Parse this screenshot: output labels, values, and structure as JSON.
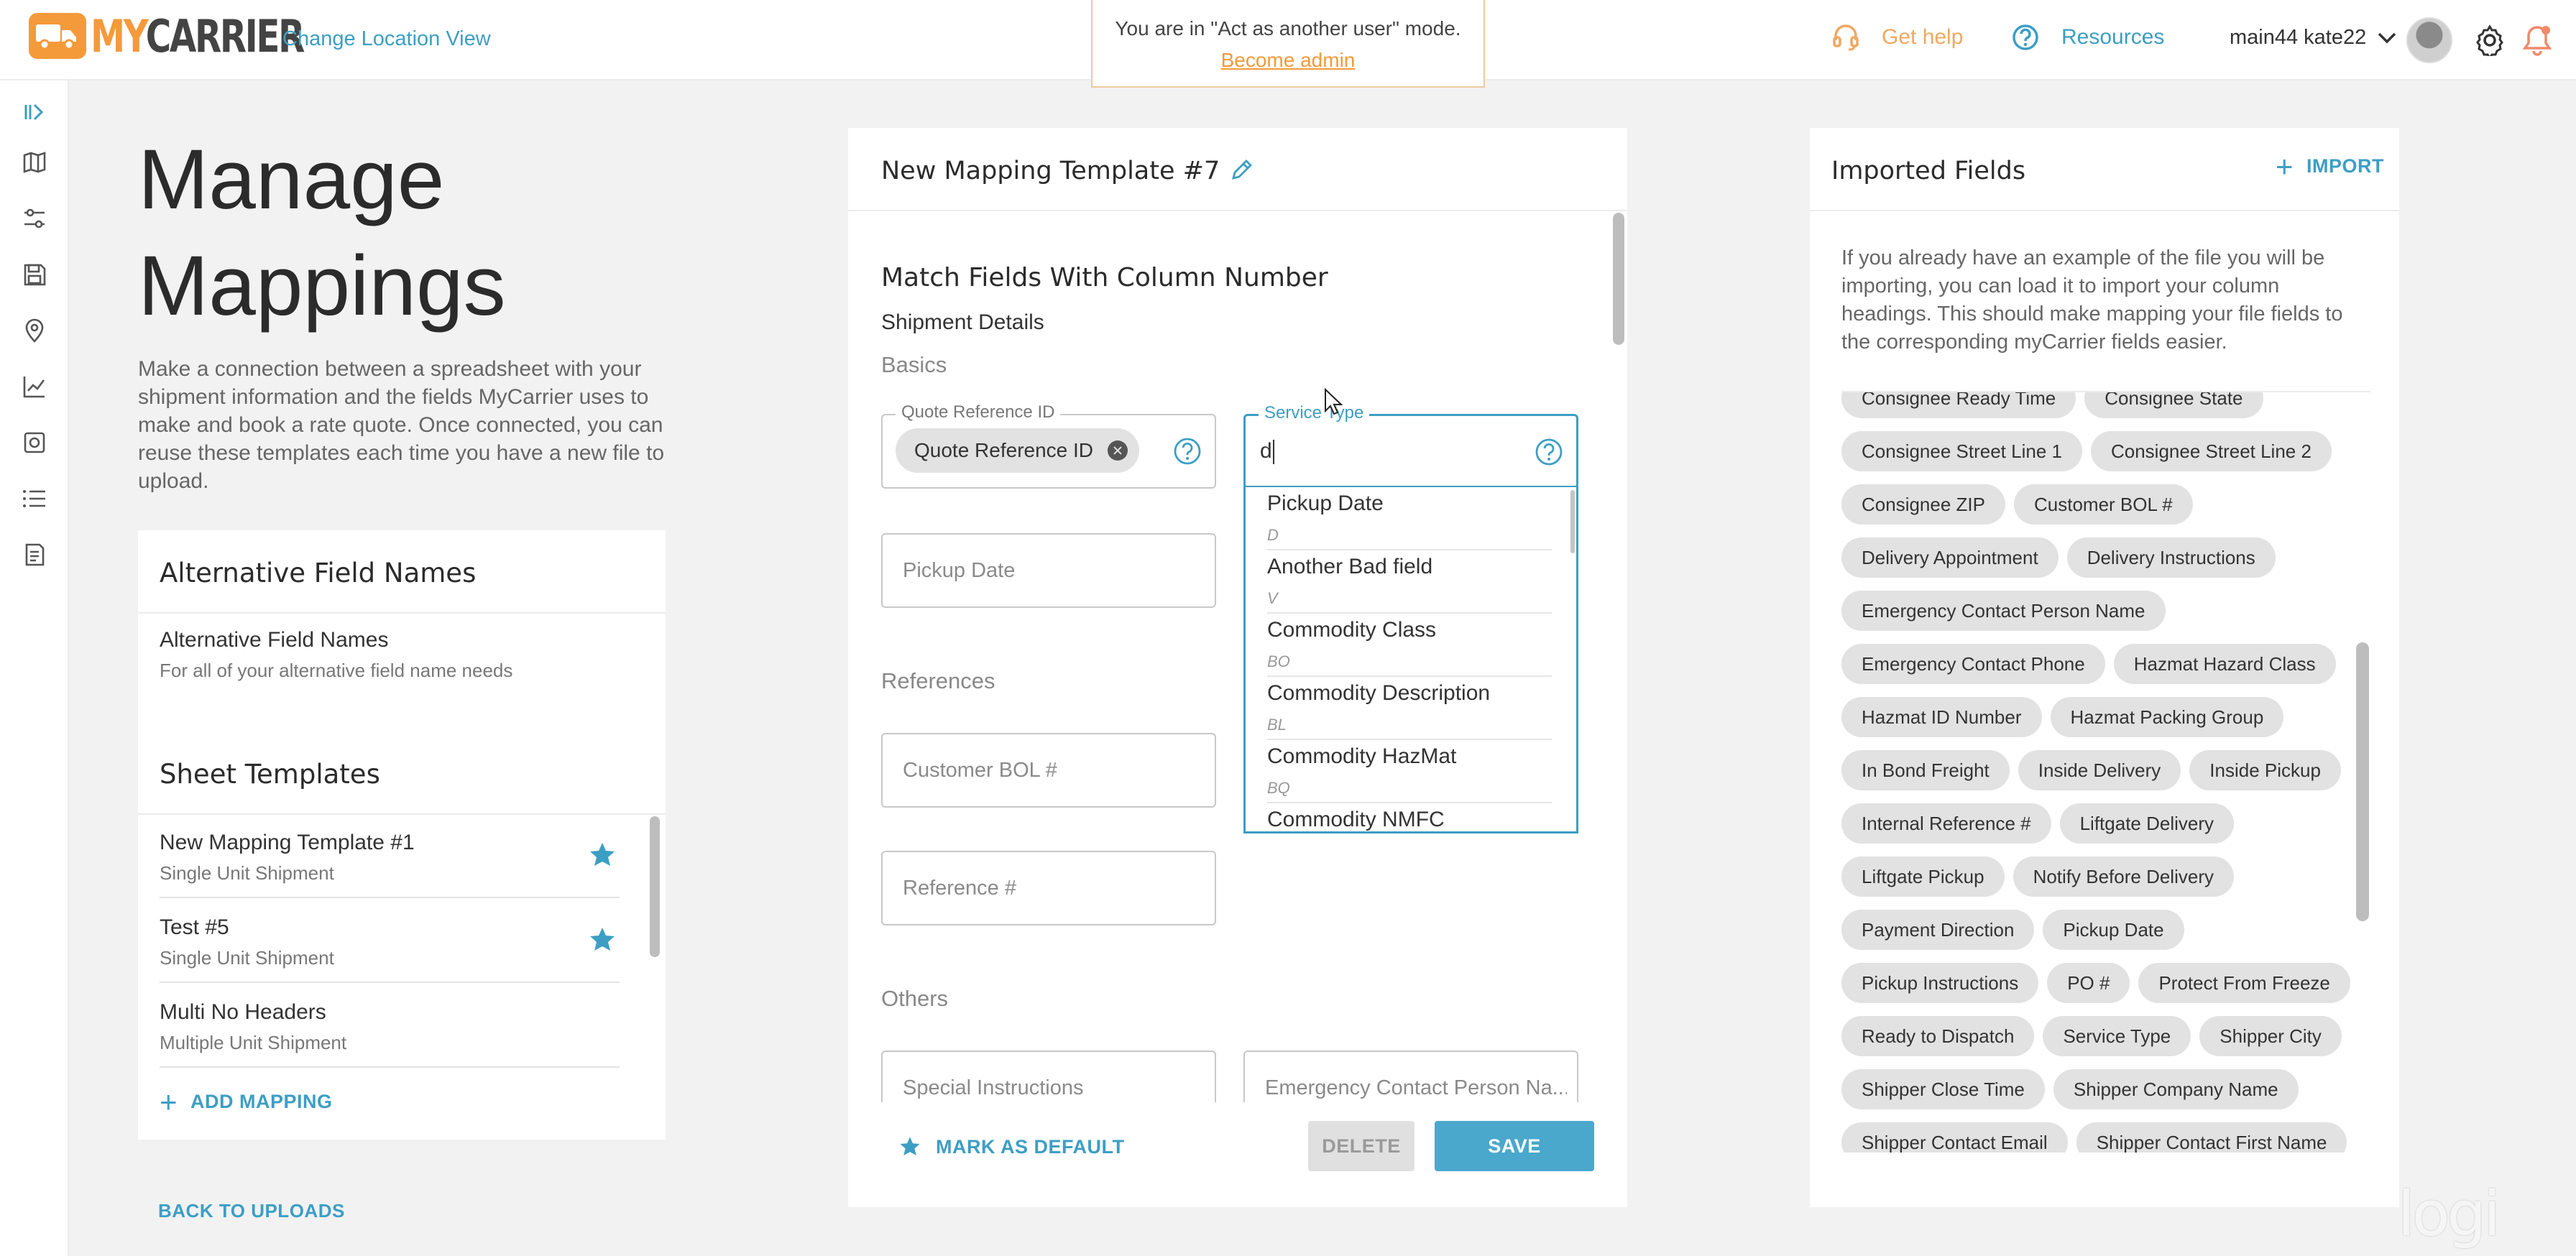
{
  "header": {
    "logo_my": "MY",
    "logo_carrier": "CARRIER",
    "change_location": "Change Location View",
    "banner_message": "You are in \"Act as another user\" mode.",
    "banner_link": "Become admin",
    "get_help": "Get help",
    "resources": "Resources",
    "user_name": "main44 kate22"
  },
  "left": {
    "title_line1": "Manage",
    "title_line2": "Mappings",
    "description": "Make a connection between a spreadsheet with your shipment information and the fields MyCarrier uses to make and book a rate quote. Once connected, you can reuse these templates each time you have a new file to upload.",
    "alt_card": {
      "title": "Alternative Field Names",
      "item_title": "Alternative Field Names",
      "item_sub": "For all of your alternative field name needs"
    },
    "sheet_card": {
      "title": "Sheet Templates",
      "rows": [
        {
          "title": "New Mapping Template #1",
          "sub": "Single Unit Shipment"
        },
        {
          "title": "Test #5",
          "sub": "Single Unit Shipment"
        },
        {
          "title": "Multi No Headers",
          "sub": "Multiple Unit Shipment"
        }
      ],
      "add_mapping": "ADD MAPPING"
    },
    "back_to_uploads": "BACK TO UPLOADS"
  },
  "middle": {
    "template_name": "New Mapping Template #7",
    "section_heading": "Match Fields With Column Number",
    "section_sub": "Shipment Details",
    "group_basics": "Basics",
    "group_references": "References",
    "group_others": "Others",
    "quote_ref": {
      "label": "Quote Reference ID",
      "chip": "Quote Reference ID"
    },
    "service_type": {
      "label": "Service Type",
      "value": "d"
    },
    "pickup_date": "Pickup Date",
    "customer_bol": "Customer BOL #",
    "reference": "Reference #",
    "special_instructions": "Special Instructions",
    "emergency_contact": "Emergency Contact Person Na...",
    "dropdown": [
      {
        "name": "Pickup Date",
        "code": "D"
      },
      {
        "name": "Another Bad field",
        "code": "V"
      },
      {
        "name": "Commodity Class",
        "code": "BO"
      },
      {
        "name": "Commodity Description",
        "code": "BL"
      },
      {
        "name": "Commodity HazMat",
        "code": "BQ"
      },
      {
        "name": "Commodity NMFC",
        "code": ""
      }
    ],
    "mark_default": "MARK AS DEFAULT",
    "delete": "DELETE",
    "save": "SAVE"
  },
  "right": {
    "title": "Imported Fields",
    "import": "IMPORT",
    "description": "If you already have an example of the file you will be importing, you can load it to import your column headings. This should make mapping your file fields to the corresponding myCarrier fields easier.",
    "chip_lines": [
      [
        "Consignee Ready Time",
        "Consignee State"
      ],
      [
        "Consignee Street Line 1",
        "Consignee Street Line 2"
      ],
      [
        "Consignee ZIP",
        "Customer BOL #"
      ],
      [
        "Delivery Appointment",
        "Delivery Instructions"
      ],
      [
        "Emergency Contact Person Name"
      ],
      [
        "Emergency Contact Phone",
        "Hazmat Hazard Class"
      ],
      [
        "Hazmat ID Number",
        "Hazmat Packing Group"
      ],
      [
        "In Bond Freight",
        "Inside Delivery",
        "Inside Pickup"
      ],
      [
        "Internal Reference #",
        "Liftgate Delivery"
      ],
      [
        "Liftgate Pickup",
        "Notify Before Delivery"
      ],
      [
        "Payment Direction",
        "Pickup Date"
      ],
      [
        "Pickup Instructions",
        "PO #",
        "Protect From Freeze"
      ],
      [
        "Ready to Dispatch",
        "Service Type",
        "Shipper City"
      ],
      [
        "Shipper Close Time",
        "Shipper Company Name"
      ],
      [
        "Shipper Contact Email",
        "Shipper Contact First Name"
      ]
    ]
  },
  "watermark": "logi",
  "colors": {
    "accent": "#3d9ec4",
    "brand": "#f49a3a"
  }
}
